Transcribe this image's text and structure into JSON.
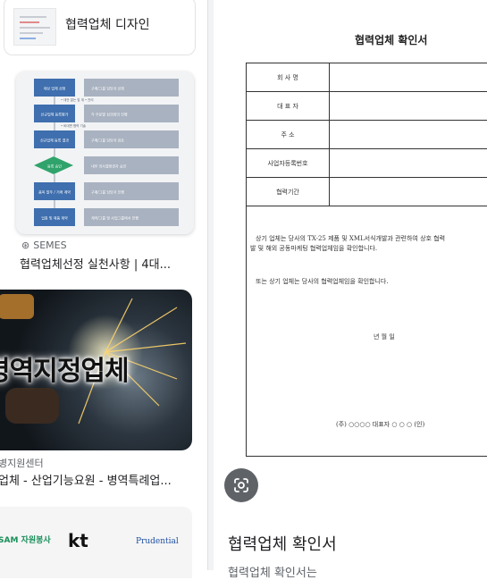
{
  "results": [
    {
      "title": "협력업체 디자인"
    },
    {
      "source": "SEMES",
      "title": "협력업체선정 실천사항 | 4대..."
    },
    {
      "image_text": "병역지정업체",
      "source": "병지원센터",
      "title": "업체 - 산업기능요원 - 병역특례업..."
    },
    {
      "logos": [
        "SAM 자원봉사",
        "kt",
        "Prudential"
      ]
    }
  ],
  "flowchart": {
    "left_steps": [
      "대상 업체 선정",
      "신규업체 등록평가",
      "신규업체 등록 결과",
      "등록 승인",
      "품목 발주 / 거래 계약",
      "업종 및 제품 계약"
    ],
    "right_steps": [
      "구매/그룹 담당자 선정",
      "각 부문별 심의회의 진행",
      "구매/그룹 담당자 검토",
      "내부 의사결정권자 승인",
      "구매/그룹 담당자 진행",
      "계약/그룹 및 사업그룹에서 진행"
    ],
    "notes": [
      "• 대안 없는 업 계 • 관리",
      "• 비대면 협력 기술"
    ]
  },
  "document": {
    "title": "협력업체 확인서",
    "fields": [
      "회 사 명",
      "대 표 자",
      "주 소",
      "사업자등록번호",
      "협력기간"
    ],
    "para1_line1": "상기 업체는 당사의 TX-25 제품 및 XML서식개발과 관련하여 상호 협력",
    "para1_line2": "발 및 해외 공동마케팅 협력업체임을 확인합니다.",
    "para2": "또는 상기 업체는 당사의 협력업체임을 확인합니다.",
    "date": "년    월    일",
    "signature": "(주) ○○○○      대표자  ○ ○ ○ (인)"
  },
  "result_title": "협력업체 확인서",
  "result_subtitle_plain": "협력업체 확인서는 ",
  "result_subtitle_bold": "",
  "colors": {
    "accent_blue": "#3f6fae",
    "green": "#2fa36b",
    "gray_box": "#a9b2c0"
  },
  "icons": {
    "lens": "google-lens-icon",
    "globe": "globe-icon"
  }
}
